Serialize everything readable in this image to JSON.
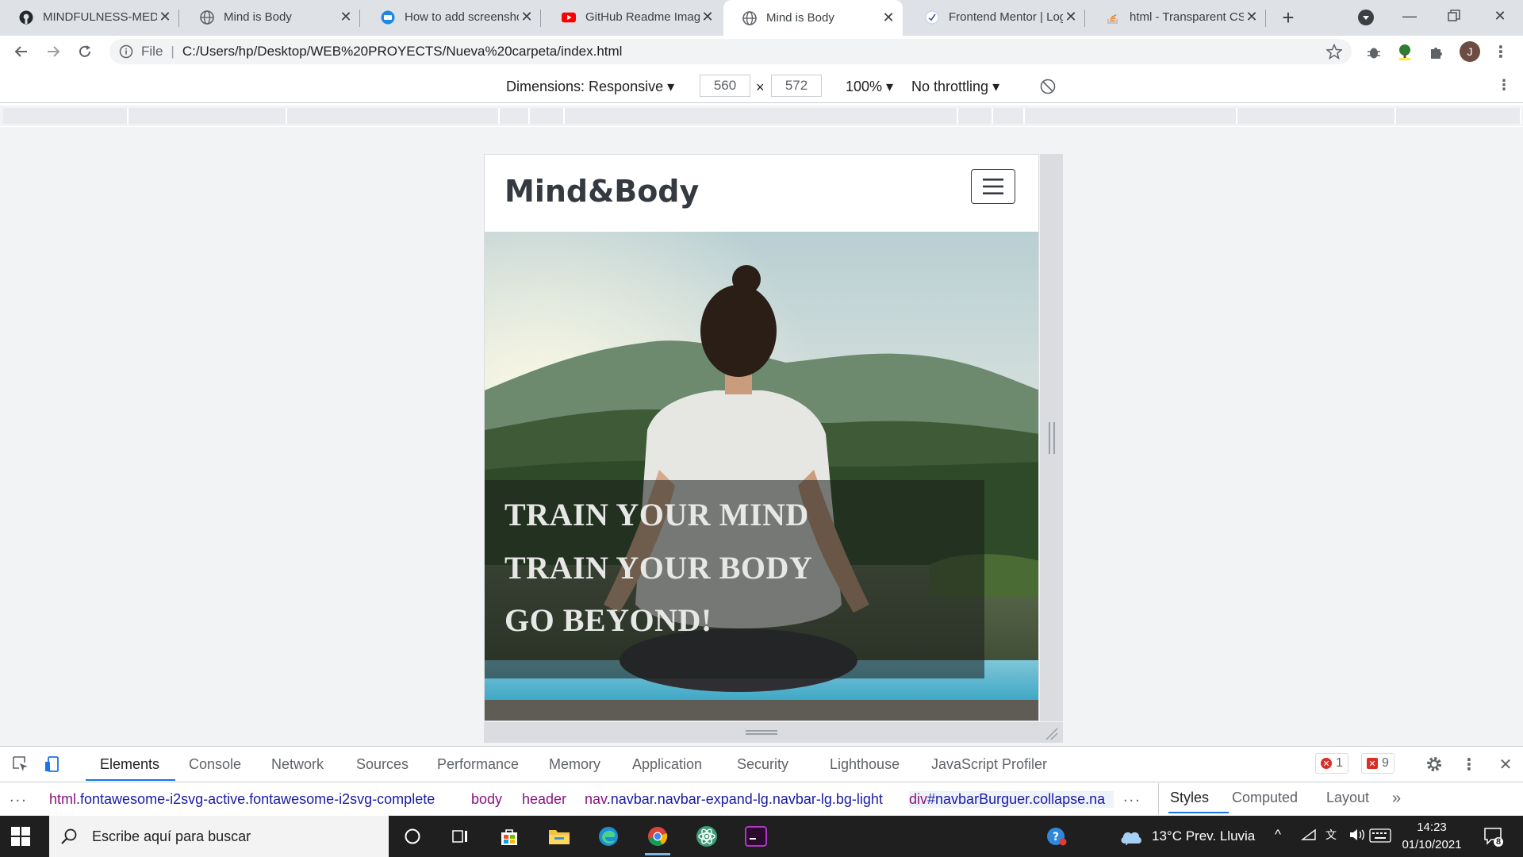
{
  "browser": {
    "tabs": [
      {
        "title": "MINDFULNESS-MEDITATION",
        "favicon": "github-icon"
      },
      {
        "title": "Mind is Body",
        "favicon": "globe-icon"
      },
      {
        "title": "How to add screenshots",
        "favicon": "web-icon"
      },
      {
        "title": "GitHub Readme Images",
        "favicon": "youtube-icon"
      },
      {
        "title": "Mind is Body",
        "favicon": "globe-icon",
        "active": true
      },
      {
        "title": "Frontend Mentor | Login",
        "favicon": "frontend-mentor-icon"
      },
      {
        "title": "html - Transparent CSS",
        "favicon": "stackoverflow-icon"
      }
    ],
    "omnibox": {
      "scheme_label": "File",
      "url": "C:/Users/hp/Desktop/WEB%20PROYECTS/Nueva%20carpeta/index.html"
    }
  },
  "device_toolbar": {
    "dimensions_label": "Dimensions: Responsive",
    "width": "560",
    "times": "×",
    "height": "572",
    "zoom": "100%",
    "throttling": "No throttling"
  },
  "site": {
    "brand": "Mind&Body",
    "hero_lines": [
      "TRAIN YOUR MIND",
      "TRAIN YOUR BODY",
      "GO BEYOND!"
    ],
    "hero_image": "woman-meditating-by-lake-photo"
  },
  "devtools": {
    "tabs": [
      "Elements",
      "Console",
      "Network",
      "Sources",
      "Performance",
      "Memory",
      "Application",
      "Security",
      "Lighthouse",
      "JavaScript Profiler"
    ],
    "active_tab": "Elements",
    "errors_count": "1",
    "issues_count": "9",
    "breadcrumbs": [
      {
        "tag": "html",
        "rest": ".fontawesome-i2svg-active.fontawesome-i2svg-complete"
      },
      {
        "tag": "body",
        "rest": ""
      },
      {
        "tag": "header",
        "rest": ""
      },
      {
        "tag": "nav",
        "rest": ".navbar.navbar-expand-lg.navbar-lg.bg-light"
      },
      {
        "tag": "div",
        "rest": "#navbarBurguer.collapse.na"
      }
    ],
    "side_tabs": [
      "Styles",
      "Computed",
      "Layout"
    ],
    "more": "»",
    "ellipsis": "..."
  },
  "taskbar": {
    "search_placeholder": "Escribe aquí para buscar",
    "weather": "13°C  Prev. Lluvia",
    "time": "14:23",
    "date": "01/10/2021",
    "notifications": "8"
  },
  "colors": {
    "tabstrip": "#dee1e6",
    "accent": "#1a73e8",
    "brand_text": "#343a40",
    "taskbar": "#1f1f1f"
  }
}
